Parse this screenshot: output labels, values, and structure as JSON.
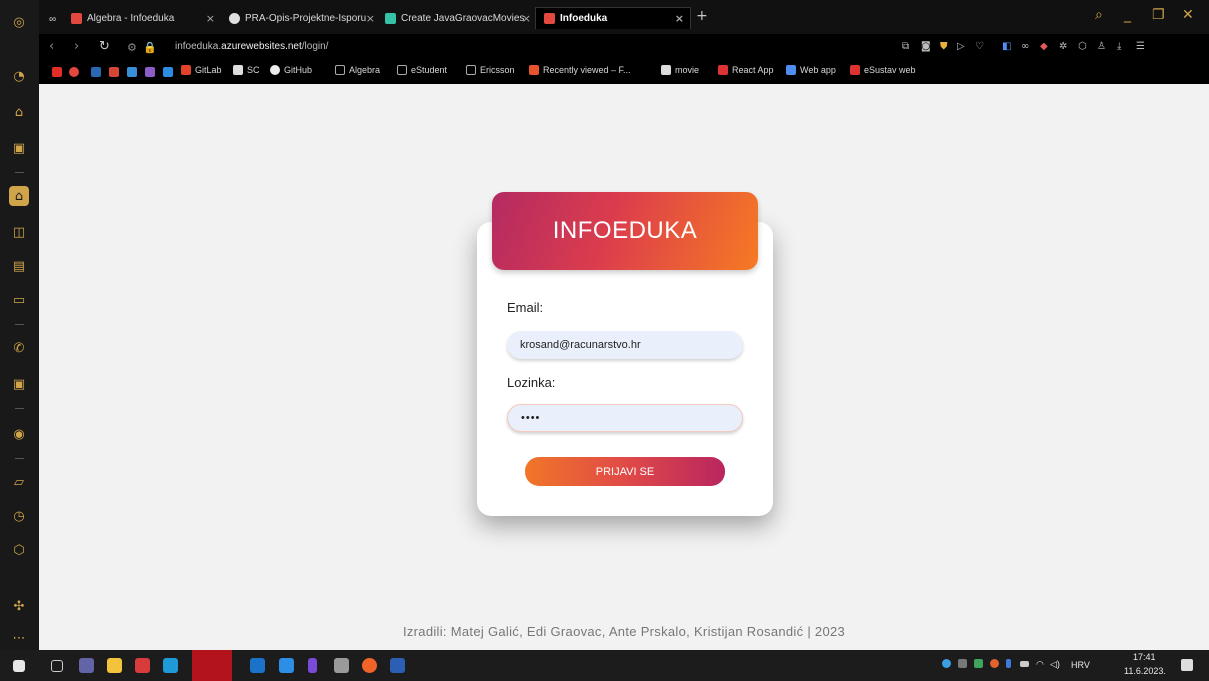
{
  "tabs": [
    {
      "title": "Algebra - Infoeduka",
      "close": "×"
    },
    {
      "title": "PRA-Opis-Projektne-Isporu",
      "close": "×"
    },
    {
      "title": "Create JavaGraovacMovies",
      "close": "×"
    },
    {
      "title": "Infoeduka",
      "close": "×",
      "active": true
    }
  ],
  "tabbar": {
    "workspace_icon": "workspaces-icon",
    "new_tab": "+"
  },
  "address_bar": {
    "url_prefix": "infoeduka.",
    "url_domain": "azurewebsites.net",
    "url_path": "/login/"
  },
  "bookmarks": [
    {
      "label": "GitLab"
    },
    {
      "label": "SC"
    },
    {
      "label": "GitHub"
    },
    {
      "label": "Algebra"
    },
    {
      "label": "eStudent"
    },
    {
      "label": "Ericsson"
    },
    {
      "label": "Recently viewed – F..."
    },
    {
      "label": "movie"
    },
    {
      "label": "React App"
    },
    {
      "label": "Web app"
    },
    {
      "label": "eSustav web"
    }
  ],
  "login": {
    "title": "INFOEDUKA",
    "email_label": "Email:",
    "email_value": "krosand@racunarstvo.hr",
    "password_label": "Lozinka:",
    "password_value": "••••",
    "submit_label": "PRIJAVI SE"
  },
  "footer": {
    "text": "Izradili: Matej Galić, Edi Graovac, Ante Prskalo, Kristijan Rosandić | 2023"
  },
  "taskbar": {
    "language": "HRV",
    "time": "17:41",
    "date": "11.6.2023."
  },
  "colors": {
    "accent": "#cfa44a",
    "gradient_start": "#b42a62",
    "gradient_end": "#f67a23",
    "page_bg": "#f2f2f2"
  }
}
